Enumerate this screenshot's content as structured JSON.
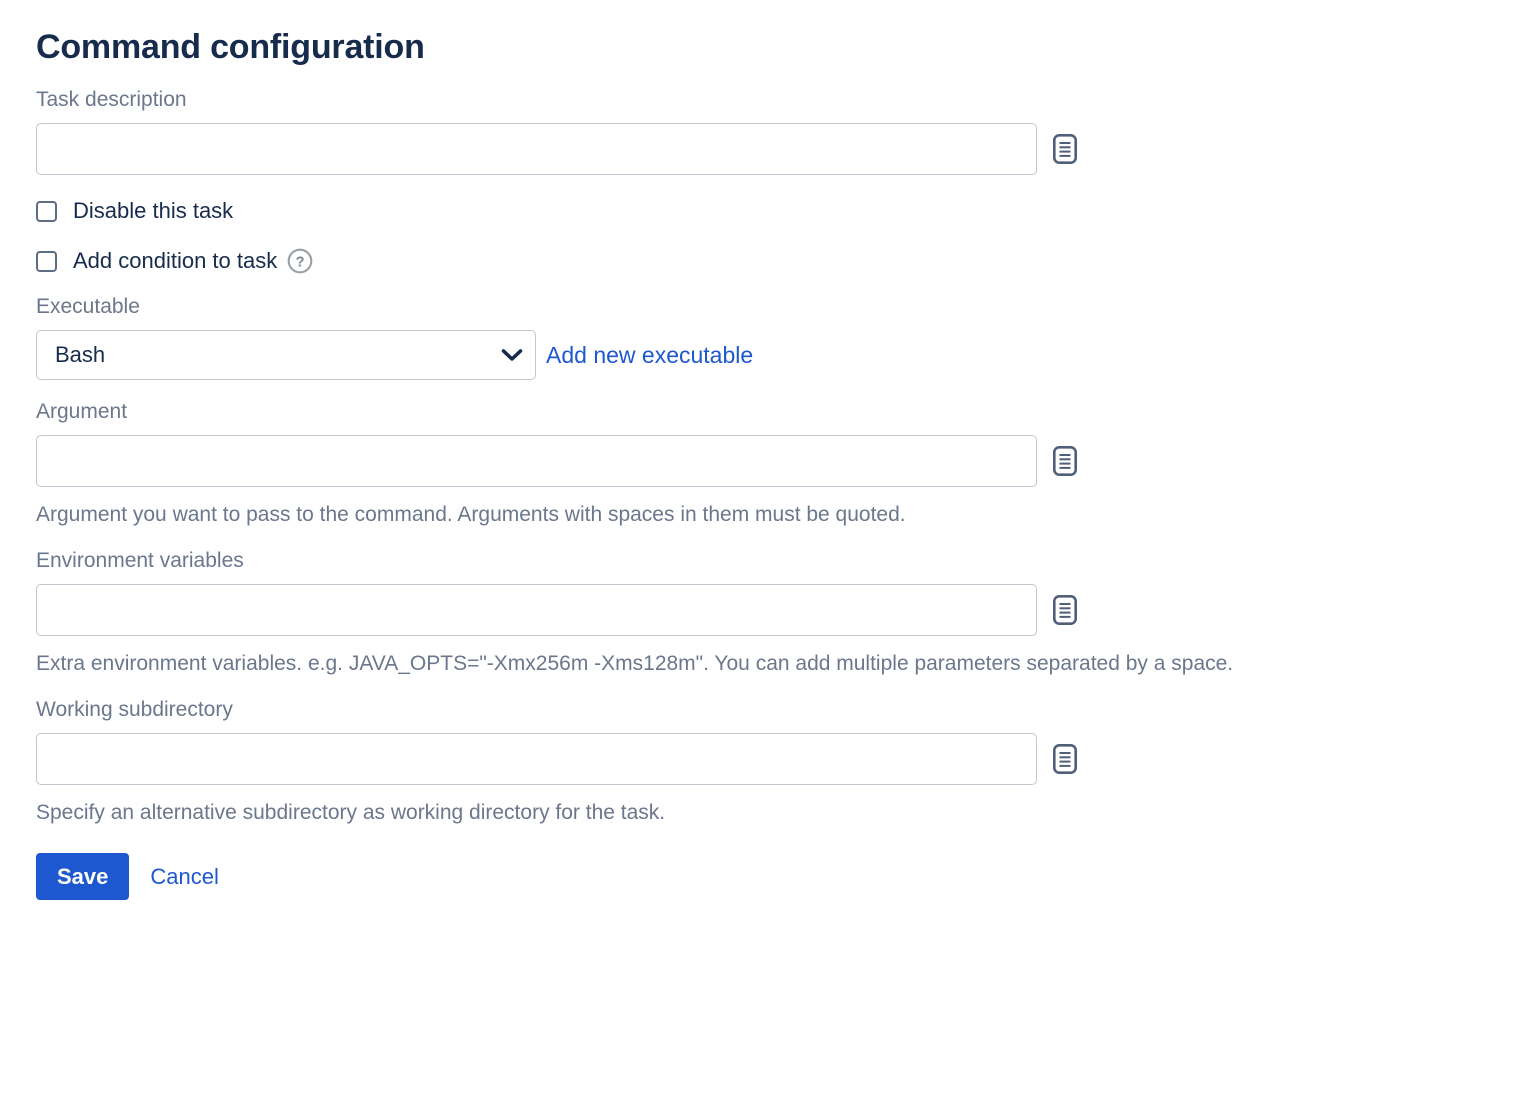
{
  "form": {
    "title": "Command configuration",
    "colors": {
      "accent": "#1d58d0",
      "title": "#172b4d",
      "label": "#6b778c",
      "border": "#c1c7d0"
    },
    "task_description": {
      "label": "Task description",
      "value": "",
      "placeholder": "",
      "icon": "document-lines-icon"
    },
    "disable_task": {
      "label": "Disable this task",
      "checked": false
    },
    "add_condition": {
      "label": "Add condition to task",
      "checked": false,
      "help_icon": "question-circle-icon"
    },
    "executable": {
      "label": "Executable",
      "value": "Bash",
      "options": [
        "Bash"
      ],
      "chevron_icon": "chevron-down-icon",
      "add_link": "Add new executable"
    },
    "argument": {
      "label": "Argument",
      "value": "",
      "placeholder": "",
      "icon": "document-lines-icon",
      "help": "Argument you want to pass to the command. Arguments with spaces in them must be quoted."
    },
    "environment_variables": {
      "label": "Environment variables",
      "value": "",
      "placeholder": "",
      "icon": "document-lines-icon",
      "help": "Extra environment variables. e.g. JAVA_OPTS=\"-Xmx256m -Xms128m\". You can add multiple parameters separated by a space."
    },
    "working_subdirectory": {
      "label": "Working subdirectory",
      "value": "",
      "placeholder": "",
      "icon": "document-lines-icon",
      "help": "Specify an alternative subdirectory as working directory for the task."
    },
    "actions": {
      "save_label": "Save",
      "cancel_label": "Cancel"
    }
  }
}
